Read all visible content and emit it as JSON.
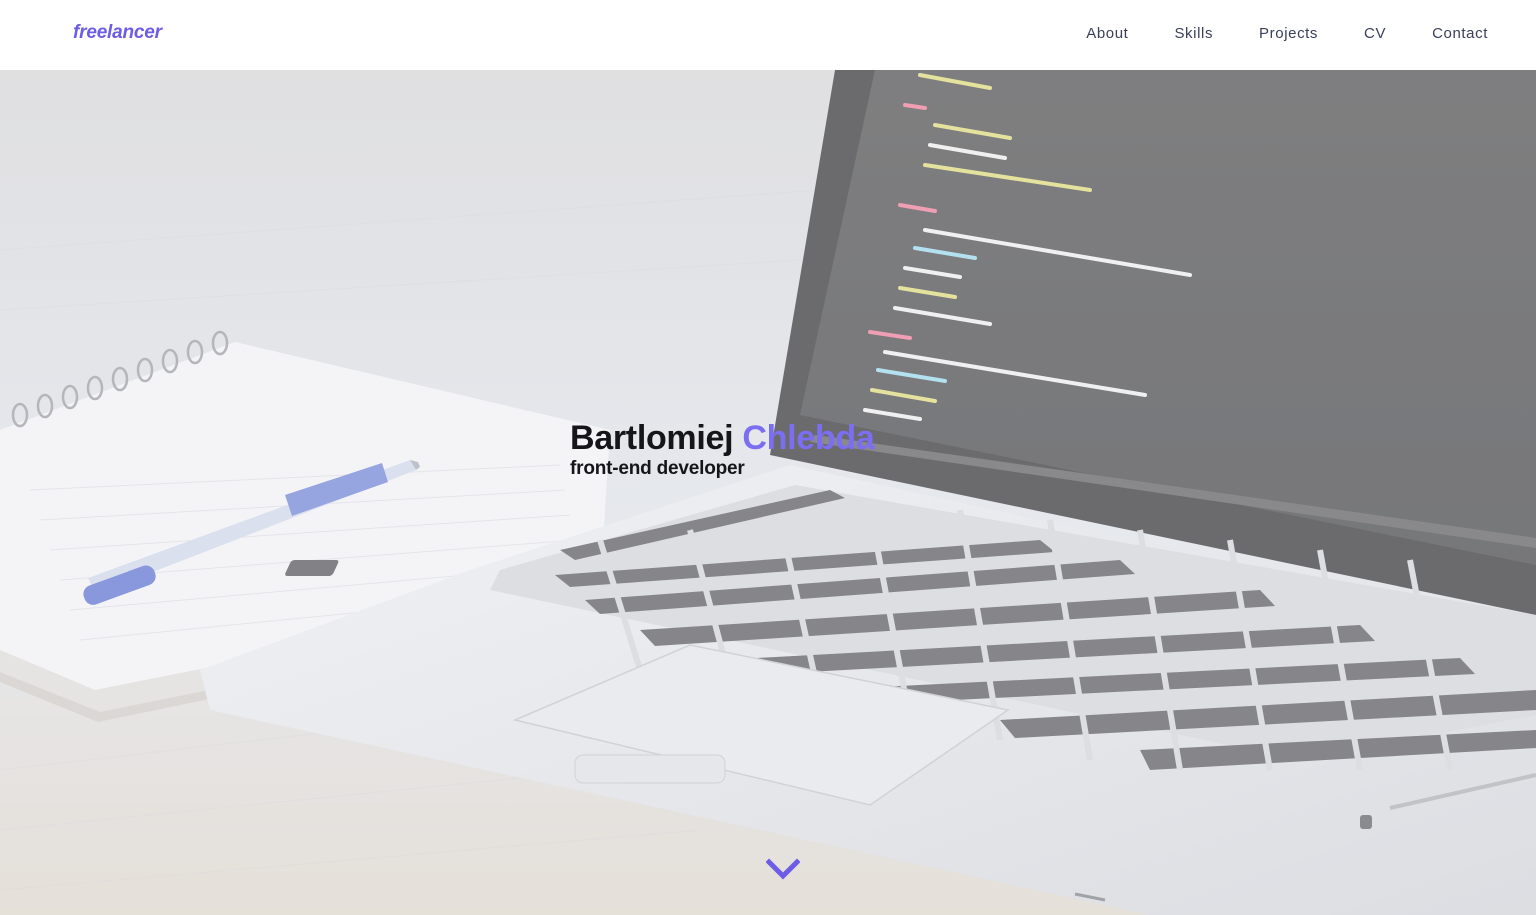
{
  "brand": {
    "logo_text": "freelancer"
  },
  "nav": {
    "items": [
      {
        "label": "About"
      },
      {
        "label": "Skills"
      },
      {
        "label": "Projects"
      },
      {
        "label": "CV"
      },
      {
        "label": "Contact"
      }
    ]
  },
  "hero": {
    "first_name": "Bartlomiej",
    "last_name": "Chlebda",
    "role": "front-end developer",
    "scroll_icon": "chevron-down-icon",
    "background_image": "laptop-with-code-and-notebook"
  },
  "colors": {
    "accent": "#6c5ce7",
    "nav_text": "#3a3f5a",
    "hero_text": "#15151a"
  }
}
